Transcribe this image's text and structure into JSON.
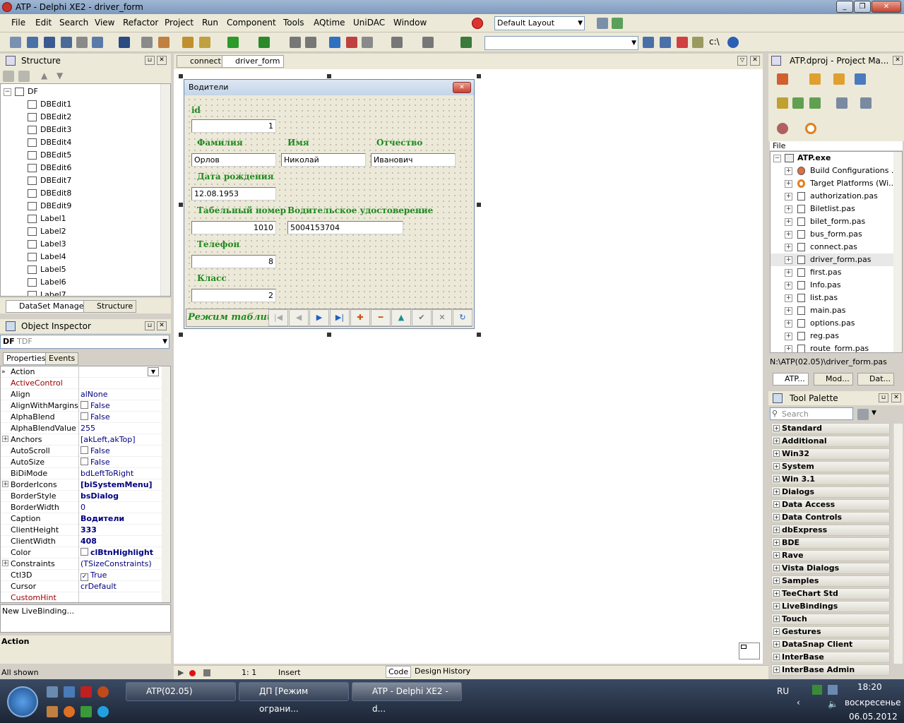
{
  "window": {
    "title": "ATP - Delphi XE2 - driver_form"
  },
  "menu": [
    "File",
    "Edit",
    "Search",
    "View",
    "Refactor",
    "Project",
    "Run",
    "Component",
    "Tools",
    "AQtime",
    "UniDAC",
    "Window"
  ],
  "toolbar": {
    "layout_combo": "Default Layout",
    "second_combo": "",
    "path_label": "c:\\"
  },
  "structure": {
    "title": "Structure",
    "root": "DF",
    "items": [
      "DBEdit1",
      "DBEdit2",
      "DBEdit3",
      "DBEdit4",
      "DBEdit5",
      "DBEdit6",
      "DBEdit7",
      "DBEdit8",
      "DBEdit9",
      "Label1",
      "Label2",
      "Label3",
      "Label4",
      "Label5",
      "Label6",
      "Label7"
    ],
    "tabs": [
      "DataSet Manager",
      "Structure"
    ]
  },
  "object_inspector": {
    "title": "Object Inspector",
    "selector_name": "DF",
    "selector_type": "TDF",
    "tabs": [
      "Properties",
      "Events"
    ],
    "properties": [
      {
        "name": "Action",
        "value": ""
      },
      {
        "name": "ActiveControl",
        "value": ""
      },
      {
        "name": "Align",
        "value": "alNone"
      },
      {
        "name": "AlignWithMargins",
        "value": "False",
        "check": true
      },
      {
        "name": "AlphaBlend",
        "value": "False",
        "check": true
      },
      {
        "name": "AlphaBlendValue",
        "value": "255"
      },
      {
        "name": "Anchors",
        "value": "[akLeft,akTop]",
        "expand": true
      },
      {
        "name": "AutoScroll",
        "value": "False",
        "check": true
      },
      {
        "name": "AutoSize",
        "value": "False",
        "check": true
      },
      {
        "name": "BiDiMode",
        "value": "bdLeftToRight"
      },
      {
        "name": "BorderIcons",
        "value": "[biSystemMenu]",
        "expand": true,
        "bold": true
      },
      {
        "name": "BorderStyle",
        "value": "bsDialog",
        "bold": true
      },
      {
        "name": "BorderWidth",
        "value": "0"
      },
      {
        "name": "Caption",
        "value": "Водители",
        "bold": true
      },
      {
        "name": "ClientHeight",
        "value": "333",
        "bold": true
      },
      {
        "name": "ClientWidth",
        "value": "408",
        "bold": true
      },
      {
        "name": "Color",
        "value": "clBtnHighlight",
        "bold": true,
        "check": true
      },
      {
        "name": "Constraints",
        "value": "(TSizeConstraints)",
        "expand": true
      },
      {
        "name": "Ctl3D",
        "value": "True",
        "check": true,
        "checked": true
      },
      {
        "name": "Cursor",
        "value": "crDefault"
      },
      {
        "name": "CustomHint",
        "value": ""
      }
    ],
    "livebinding": "New LiveBinding...",
    "desc_title": "Action",
    "status": "All shown"
  },
  "editor_tabs": [
    "connect",
    "driver_form"
  ],
  "form": {
    "caption": "Водители",
    "labels": {
      "id": "id",
      "fam": "Фамилия",
      "name": "Имя",
      "otch": "Отчество",
      "dob": "Дата рождения",
      "tab": "Табельный номер",
      "lic": "Водительское удостоверение",
      "phone": "Телефон",
      "cls": "Класс"
    },
    "values": {
      "id": "1",
      "fam": "Орлов",
      "name": "Николай",
      "otch": "Иванович",
      "dob": "12.08.1953",
      "tab": "1010",
      "lic": "5004153704",
      "phone": "8",
      "cls": "2"
    },
    "mode_label": "Режим таблицы"
  },
  "status_bar": {
    "position": "1:  1",
    "mode": "Insert",
    "tabs": [
      "Code",
      "Design",
      "History"
    ]
  },
  "project_manager": {
    "title": "ATP.dproj - Project Ma...",
    "file_label": "File",
    "root": "ATP.exe",
    "items": [
      "Build Configurations ...",
      "Target Platforms (Wi...",
      "authorization.pas",
      "Biletlist.pas",
      "bilet_form.pas",
      "bus_form.pas",
      "connect.pas",
      "driver_form.pas",
      "first.pas",
      "Info.pas",
      "list.pas",
      "main.pas",
      "options.pas",
      "reg.pas",
      "route_form.pas"
    ],
    "path": "N:\\ATP(02.05)\\driver_form.pas",
    "tabs": [
      "ATP...",
      "Mod...",
      "Dat..."
    ]
  },
  "tool_palette": {
    "title": "Tool Palette",
    "search_placeholder": "Search",
    "categories": [
      "Standard",
      "Additional",
      "Win32",
      "System",
      "Win 3.1",
      "Dialogs",
      "Data Access",
      "Data Controls",
      "dbExpress",
      "BDE",
      "Rave",
      "Vista Dialogs",
      "Samples",
      "TeeChart Std",
      "LiveBindings",
      "Touch",
      "Gestures",
      "DataSnap Client",
      "InterBase",
      "InterBase Admin"
    ]
  },
  "taskbar": {
    "tasks": [
      "ATP(02.05)",
      "ДП [Режим ограни...",
      "ATP - Delphi XE2 - d..."
    ],
    "lang": "RU",
    "time": "18:20",
    "day": "воскресенье",
    "date": "06.05.2012"
  }
}
